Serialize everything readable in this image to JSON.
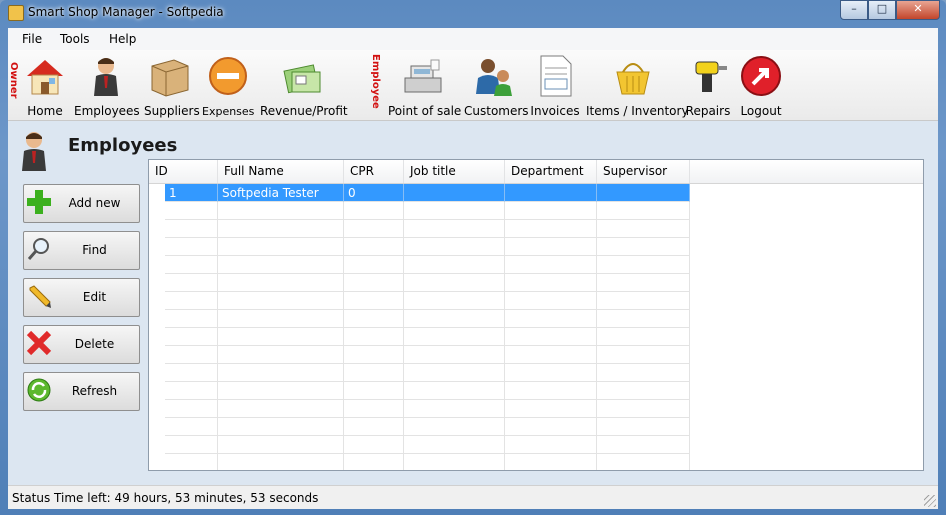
{
  "window": {
    "title": "Smart Shop Manager - Softpedia",
    "min": "–",
    "max": "□",
    "close": "✕"
  },
  "menu": [
    {
      "label": "File"
    },
    {
      "label": "Tools"
    },
    {
      "label": "Help"
    }
  ],
  "toolbar": {
    "owner_label": "Owner",
    "employee_label": "Employee",
    "owner_items": [
      {
        "label": "Home",
        "icon": "home-icon"
      },
      {
        "label": "Employees",
        "icon": "employee-icon"
      },
      {
        "label": "Suppliers",
        "icon": "supplier-box-icon"
      },
      {
        "label": "Expenses",
        "icon": "expenses-icon"
      },
      {
        "label": "Revenue/Profit",
        "icon": "revenue-icon"
      }
    ],
    "employee_items": [
      {
        "label": "Point of sale",
        "icon": "cash-register-icon"
      },
      {
        "label": "Customers",
        "icon": "customers-icon"
      },
      {
        "label": "Invoices",
        "icon": "invoice-icon"
      },
      {
        "label": "Items / Inventory",
        "icon": "basket-icon"
      },
      {
        "label": "Repairs",
        "icon": "drill-icon"
      },
      {
        "label": "Logout",
        "icon": "logout-icon"
      }
    ]
  },
  "section": {
    "title": "Employees"
  },
  "side_buttons": [
    {
      "label": "Add new",
      "icon": "plus-icon"
    },
    {
      "label": "Find",
      "icon": "magnifier-icon"
    },
    {
      "label": "Edit",
      "icon": "pencil-icon"
    },
    {
      "label": "Delete",
      "icon": "delete-x-icon"
    },
    {
      "label": "Refresh",
      "icon": "refresh-icon"
    }
  ],
  "table": {
    "columns": [
      "ID",
      "Full Name",
      "CPR",
      "Job title",
      "Department",
      "Supervisor"
    ],
    "rows": [
      [
        "1",
        "Softpedia Tester",
        "0",
        "",
        "",
        ""
      ]
    ]
  },
  "status": {
    "text": "Status   Time left: 49 hours, 53 minutes, 53 seconds"
  },
  "colors": {
    "accent": "#3399ff",
    "section_bg": "#dce6f1",
    "vertical_label": "#d21010"
  }
}
